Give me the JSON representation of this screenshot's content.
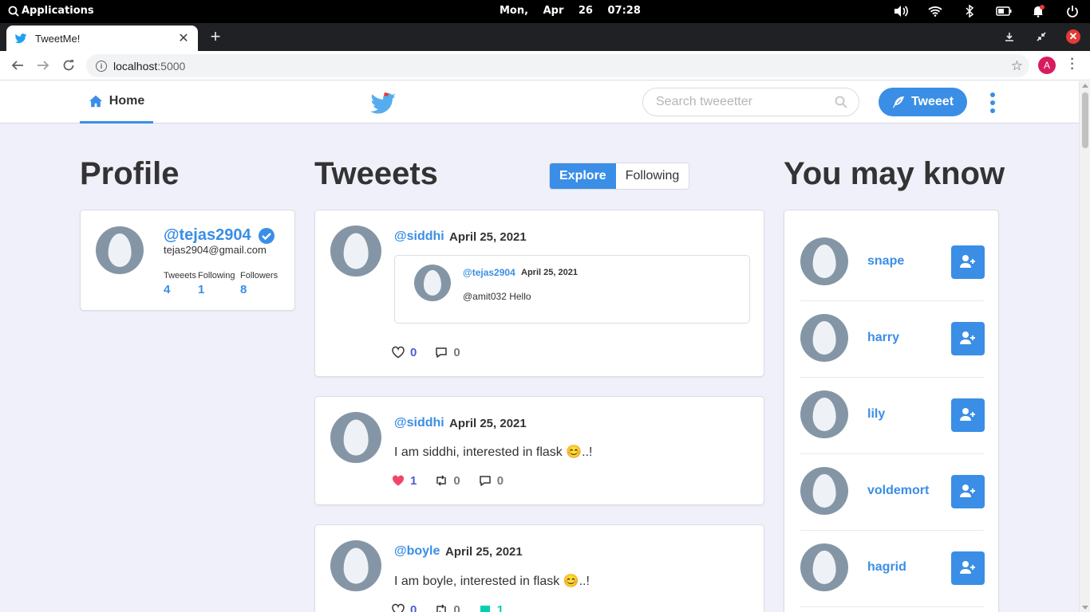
{
  "os": {
    "apps_label": "Applications",
    "date": "Mon, Apr 26",
    "time": "07:28"
  },
  "browser": {
    "tab_title": "TweetMe!",
    "url_host": "localhost",
    "url_port": ":5000",
    "account_initial": "A"
  },
  "nav": {
    "home_label": "Home",
    "search_placeholder": "Search tweeetter",
    "tweet_button": "Tweeet"
  },
  "profile": {
    "heading": "Profile",
    "handle": "@tejas2904",
    "email": "tejas2904@gmail.com",
    "stats": [
      {
        "label": "Tweeets",
        "value": "4"
      },
      {
        "label": "Following",
        "value": "1"
      },
      {
        "label": "Followers",
        "value": "8"
      }
    ]
  },
  "feed": {
    "heading": "Tweeets",
    "tabs": {
      "explore": "Explore",
      "following": "Following"
    },
    "tweets": [
      {
        "handle": "@siddhi",
        "date": "April 25, 2021",
        "retweet": {
          "handle": "@tejas2904",
          "date": "April 25, 2021",
          "text": "@amit032 Hello"
        },
        "likes": "0",
        "comments": "0"
      },
      {
        "handle": "@siddhi",
        "date": "April 25, 2021",
        "text": "I am siddhi, interested in flask 😊..!",
        "likes": "1",
        "retweets": "0",
        "comments": "0"
      },
      {
        "handle": "@boyle",
        "date": "April 25, 2021",
        "text": "I am boyle, interested in flask 😊..!",
        "likes": "0",
        "retweets": "0",
        "comments": "1"
      }
    ]
  },
  "suggestions": {
    "heading": "You may know",
    "users": [
      "snape",
      "harry",
      "lily",
      "voldemort",
      "hagrid"
    ]
  },
  "colors": {
    "accent": "#3a8ee6",
    "page_bg": "#f0f0fb",
    "like_active": "#f14668",
    "comment_active": "#00d1b2",
    "count_blue": "#4f5bd5"
  }
}
